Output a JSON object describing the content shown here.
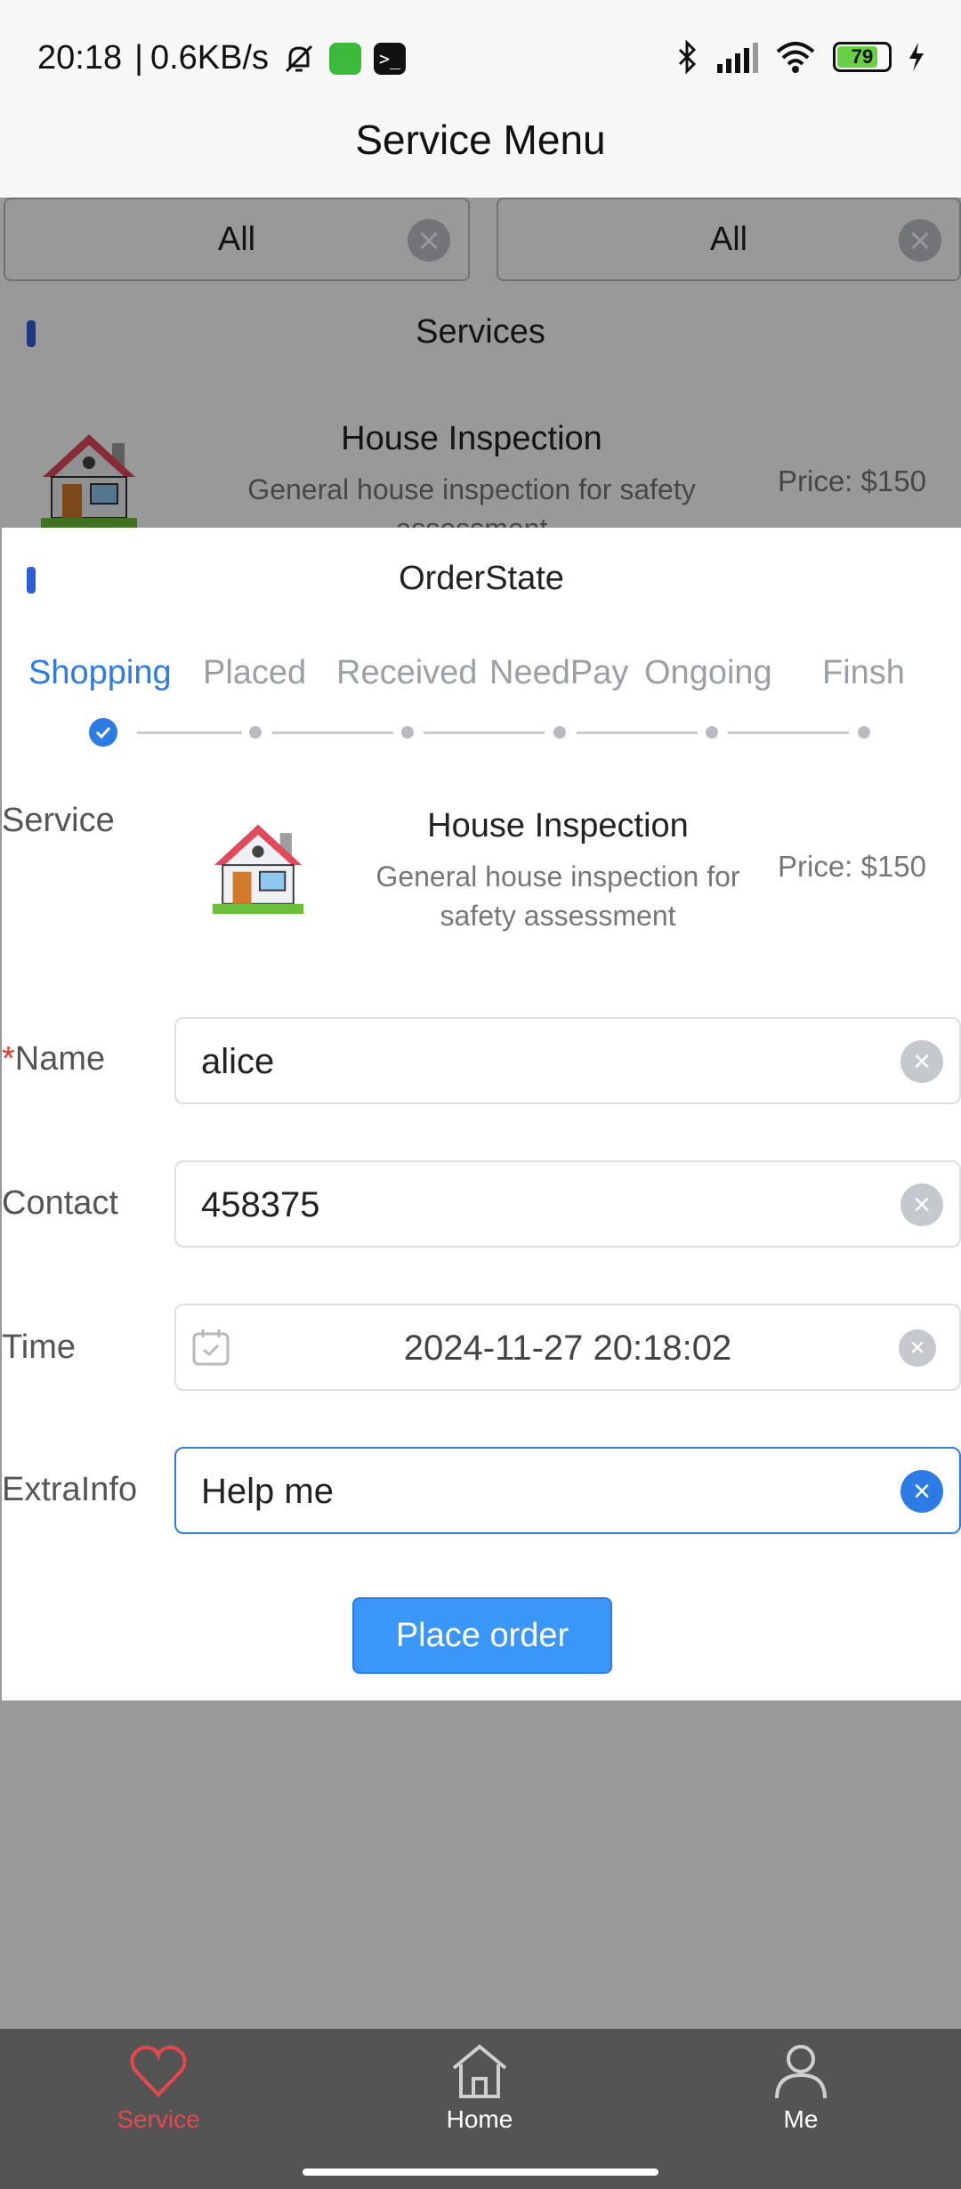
{
  "status_bar": {
    "time": "20:18",
    "separator": "|",
    "speed": "0.6KB/s",
    "battery": "79",
    "icons": [
      "mute-bell-icon",
      "app-icon",
      "terminal-icon",
      "bluetooth-icon",
      "signal-icon",
      "wifi-icon",
      "battery-icon",
      "charging-icon"
    ]
  },
  "header": {
    "title": "Service Menu"
  },
  "filters": [
    {
      "value": "All"
    },
    {
      "value": "All"
    }
  ],
  "services_section": {
    "title": "Services",
    "item": {
      "name": "House Inspection",
      "description": "General house inspection for safety assessment",
      "price": "Price: $150"
    }
  },
  "modal": {
    "title": "OrderState",
    "steps": [
      {
        "label": "Shopping",
        "active": true
      },
      {
        "label": "Placed",
        "active": false
      },
      {
        "label": "Received",
        "active": false
      },
      {
        "label": "NeedPay",
        "active": false
      },
      {
        "label": "Ongoing",
        "active": false
      },
      {
        "label": "Finsh",
        "active": false
      }
    ],
    "service": {
      "label": "Service",
      "name": "House Inspection",
      "description": "General house inspection for safety assessment",
      "price": "Price: $150"
    },
    "form": {
      "name_required_mark": "*",
      "name_label": "Name",
      "name_value": "alice",
      "contact_label": "Contact",
      "contact_value": "458375",
      "time_label": "Time",
      "time_value": "2024-11-27 20:18:02",
      "extra_label": "ExtraInfo",
      "extra_value": "Help me"
    },
    "submit_label": "Place order"
  },
  "bottom_nav": {
    "items": [
      {
        "label": "Service",
        "icon": "heart-icon",
        "active": true
      },
      {
        "label": "Home",
        "icon": "home-icon",
        "active": false
      },
      {
        "label": "Me",
        "icon": "person-icon",
        "active": false
      }
    ]
  },
  "colors": {
    "accent": "#2d7be5",
    "active_nav": "#e5484d",
    "button": "#3a96f7"
  }
}
